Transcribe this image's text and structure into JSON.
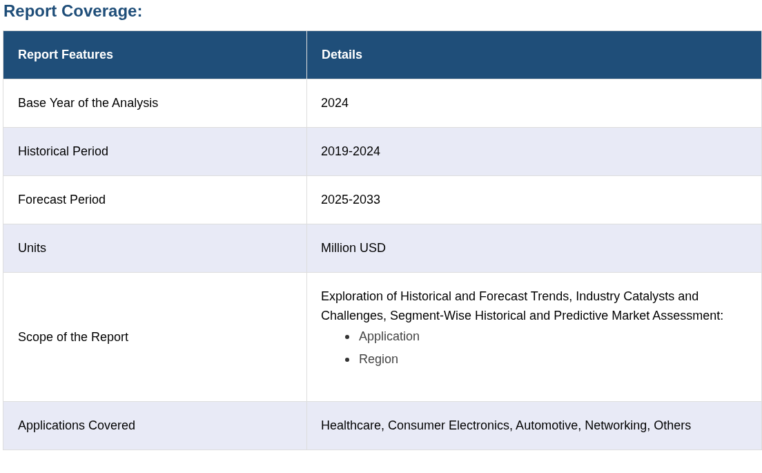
{
  "title": "Report Coverage:",
  "table": {
    "columns": [
      "Report Features",
      "Details"
    ],
    "rows": [
      {
        "feature": "Base Year of the Analysis",
        "details": "2024"
      },
      {
        "feature": "Historical Period",
        "details": "2019-2024"
      },
      {
        "feature": "Forecast Period",
        "details": "2025-2033"
      },
      {
        "feature": "Units",
        "details": "Million USD"
      },
      {
        "feature": "Scope of the Report",
        "details": "Exploration of Historical and Forecast Trends, Industry Catalysts and Challenges, Segment-Wise Historical and Predictive Market Assessment:",
        "list": [
          "Application",
          "Region"
        ]
      },
      {
        "feature": "Applications Covered",
        "details": "Healthcare, Consumer Electronics, Automotive, Networking, Others"
      }
    ]
  }
}
